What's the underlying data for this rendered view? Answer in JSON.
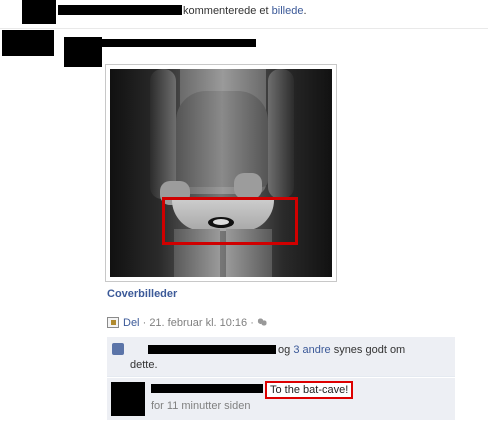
{
  "story": {
    "action_text": "kommenterede et",
    "object_link": "billede",
    "period": "."
  },
  "photo": {
    "album_link": "Coverbilleder",
    "highlight_color": "#d00000"
  },
  "meta": {
    "share_label": "Del",
    "separator": "·",
    "timestamp": "21. februar kl. 10:16",
    "audience_separator": "·"
  },
  "likes": {
    "connector": "og",
    "others_link": "3 andre",
    "suffix": "synes godt om",
    "suffix_line2": "dette."
  },
  "comment": {
    "text": "To the bat-cave!",
    "time": "for 11 minutter siden"
  },
  "colors": {
    "link": "#3b5998",
    "comment_bg": "#edeff4",
    "highlight": "#d00000"
  }
}
